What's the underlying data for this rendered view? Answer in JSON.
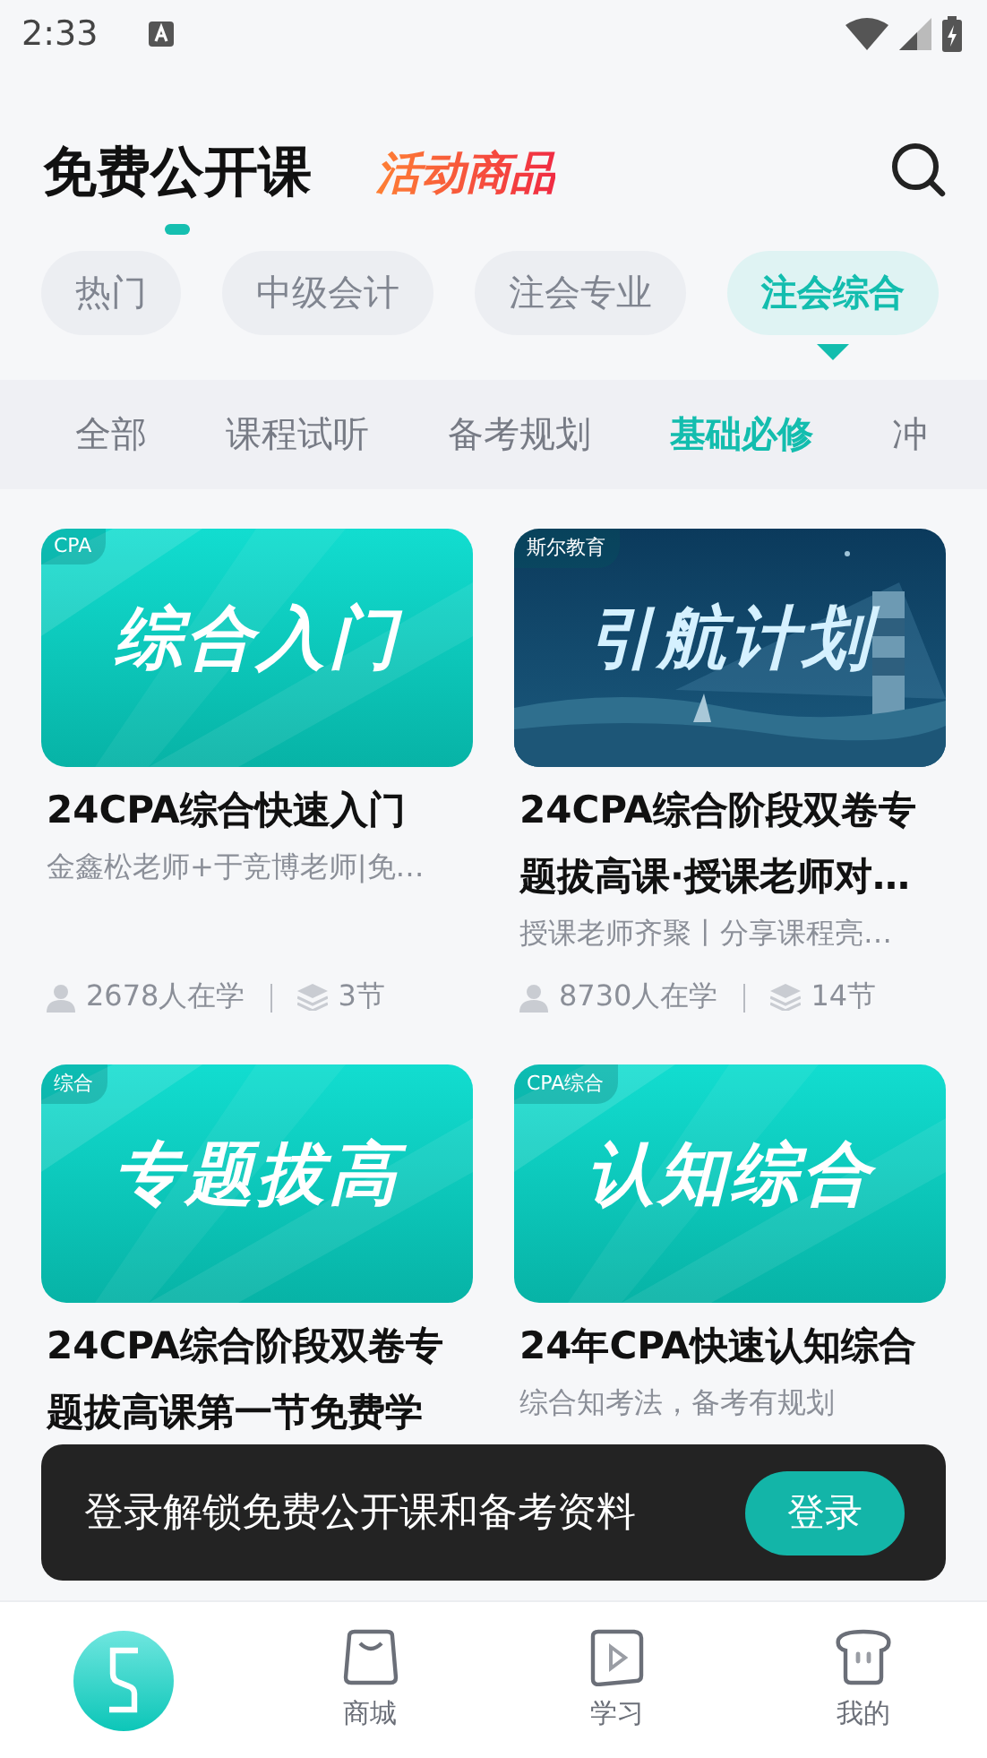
{
  "status_bar": {
    "time": "2:33"
  },
  "header": {
    "tabs": [
      {
        "label": "免费公开课",
        "kind": "plain",
        "selected": true
      },
      {
        "label": "活动商品",
        "kind": "promo",
        "selected": false
      }
    ]
  },
  "categories": [
    {
      "label": "热门",
      "selected": false
    },
    {
      "label": "中级会计",
      "selected": false
    },
    {
      "label": "注会专业",
      "selected": false
    },
    {
      "label": "注会综合",
      "selected": true
    }
  ],
  "sub_tabs": [
    {
      "label": "全部",
      "selected": false
    },
    {
      "label": "课程试听",
      "selected": false
    },
    {
      "label": "备考规划",
      "selected": false
    },
    {
      "label": "基础必修",
      "selected": true
    },
    {
      "label": "冲",
      "selected": false
    }
  ],
  "courses": [
    {
      "tag": "CPA",
      "banner_text": "综合入门",
      "kind": "teal",
      "title": "24CPA综合快速入门",
      "subtitle": "金鑫松老师+于竞博老师|免…",
      "learners": "2678人在学",
      "lessons": "3节"
    },
    {
      "tag": "斯尔教育",
      "banner_text": "引航计划",
      "kind": "night",
      "title": "24CPA综合阶段双卷专题拔高课·授课老师对…",
      "subtitle": "授课老师齐聚丨分享课程亮…",
      "learners": "8730人在学",
      "lessons": "14节"
    },
    {
      "tag": "综合",
      "banner_text": "专题拔高",
      "kind": "teal",
      "title": "24CPA综合阶段双卷专题拔高课第一节免费学"
    },
    {
      "tag": "CPA综合",
      "banner_text": "认知综合",
      "kind": "teal",
      "title": "24年CPA快速认知综合",
      "subtitle": "综合知考法，备考有规划"
    }
  ],
  "toast": {
    "message": "登录解锁免费公开课和备考资料",
    "button": "登录"
  },
  "bottom_nav": [
    {
      "kind": "logo"
    },
    {
      "kind": "tab",
      "label": "商城"
    },
    {
      "kind": "tab",
      "label": "学习"
    },
    {
      "kind": "tab",
      "label": "我的"
    }
  ]
}
